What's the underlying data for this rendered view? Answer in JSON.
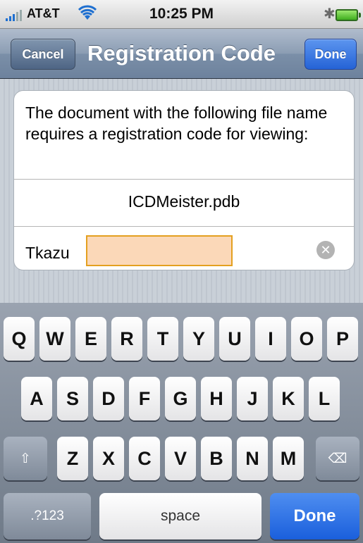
{
  "status_bar": {
    "carrier": "AT&T",
    "time": "10:25 PM"
  },
  "nav": {
    "cancel_label": "Cancel",
    "title": "Registration Code",
    "done_label": "Done"
  },
  "form": {
    "message": "The document with the following file name requires a registration code for viewing:",
    "filename": "ICDMeister.pdb",
    "code_value": "Tkazu",
    "clear_symbol": "✕"
  },
  "keyboard": {
    "row1": [
      "Q",
      "W",
      "E",
      "R",
      "T",
      "Y",
      "U",
      "I",
      "O",
      "P"
    ],
    "row2": [
      "A",
      "S",
      "D",
      "F",
      "G",
      "H",
      "J",
      "K",
      "L"
    ],
    "row3": [
      "Z",
      "X",
      "C",
      "V",
      "B",
      "N",
      "M"
    ],
    "shift_symbol": "⇧",
    "backspace_symbol": "⌫",
    "numbers_label": ".?123",
    "space_label": "space",
    "done_label": "Done"
  }
}
